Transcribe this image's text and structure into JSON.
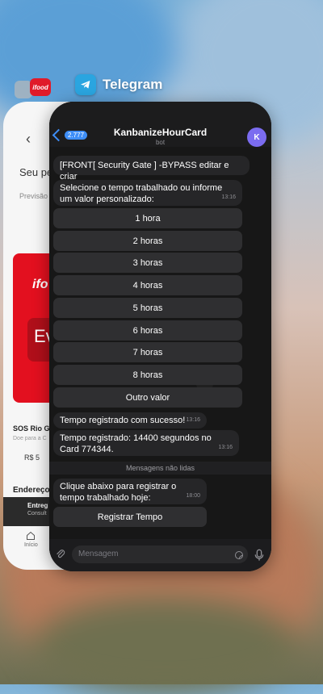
{
  "switcher": {
    "app_title": "Telegram"
  },
  "background_app": {
    "greeting": "Seu pe",
    "previsao": "Previsão",
    "banner_brand": "ifo",
    "banner_text": "Ev",
    "item_title": "SOS Rio Gra",
    "item_sub": "Doe para a C",
    "item_price": "R$ 5",
    "address": "Endereço",
    "dark_title": "Entreg",
    "dark_sub": "Consult",
    "tab_home": "Início"
  },
  "chat": {
    "back_badge": "2.777",
    "title": "KanbanizeHourCard",
    "subtitle": "bot",
    "avatar_letter": "K",
    "messages": [
      {
        "text": "[FRONT[ Security Gate ] -BYPASS editar e criar"
      },
      {
        "text": "Selecione o tempo trabalhado ou informe um valor personalizado:",
        "time": "13:16"
      }
    ],
    "keyboard": [
      "1 hora",
      "2 horas",
      "3 horas",
      "4 horas",
      "5 horas",
      "6 horas",
      "7 horas",
      "8 horas",
      "Outro valor"
    ],
    "confirm": {
      "text": "Tempo registrado com sucesso!",
      "time": "13:16"
    },
    "registered": {
      "text": "Tempo registrado: 14400 segundos no Card 774344.",
      "time": "13:16"
    },
    "unread_label": "Mensagens não lidas",
    "prompt": {
      "text": "Clique abaixo para registrar o tempo trabalhado hoje:",
      "time": "18:00"
    },
    "register_button": "Registrar Tempo",
    "input_placeholder": "Mensagem"
  }
}
